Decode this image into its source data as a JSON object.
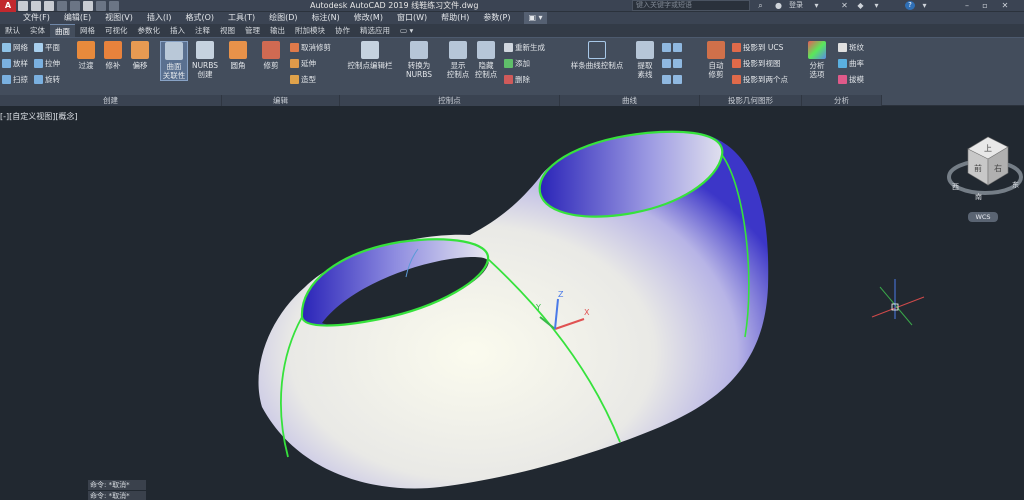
{
  "app": {
    "logo": "A",
    "title": "Autodesk AutoCAD 2019    线鞋练习文件.dwg",
    "search_placeholder": "键入关键字或短语",
    "login": "登录",
    "help": "?"
  },
  "menu": [
    "文件(F)",
    "编辑(E)",
    "视图(V)",
    "插入(I)",
    "格式(O)",
    "工具(T)",
    "绘图(D)",
    "标注(N)",
    "修改(M)",
    "窗口(W)",
    "帮助(H)",
    "参数(P)",
    "▣ ▾"
  ],
  "ribbon_tabs": [
    {
      "label": "默认",
      "active": false
    },
    {
      "label": "实体",
      "active": false
    },
    {
      "label": "曲面",
      "active": true
    },
    {
      "label": "网格",
      "active": false
    },
    {
      "label": "可视化",
      "active": false
    },
    {
      "label": "参数化",
      "active": false
    },
    {
      "label": "插入",
      "active": false
    },
    {
      "label": "注释",
      "active": false
    },
    {
      "label": "视图",
      "active": false
    },
    {
      "label": "管理",
      "active": false
    },
    {
      "label": "输出",
      "active": false
    },
    {
      "label": "附加模块",
      "active": false
    },
    {
      "label": "协作",
      "active": false
    },
    {
      "label": "精选应用",
      "active": false
    },
    {
      "label": "▭ ▾",
      "active": false
    }
  ],
  "ribbon": {
    "create": {
      "label": "创建",
      "small": [
        "网络",
        "放样",
        "扫掠",
        "平面",
        "拉伸",
        "旋转"
      ],
      "big": [
        "过渡",
        "修补",
        "偏移"
      ],
      "assoc_line1": "曲面",
      "assoc_line2": "关联性",
      "nurbs_line1": "NURBS",
      "nurbs_line2": "创建"
    },
    "edit": {
      "label": "编辑",
      "fillet": "圆角",
      "trim": "修剪",
      "small": [
        "取消修剪",
        "延伸",
        "造型"
      ]
    },
    "cv": {
      "label": "控制点",
      "cv_bar": "控制点编辑栏",
      "convert_line1": "转换为",
      "convert_line2": "NURBS",
      "show_line1": "显示",
      "show_line2": "控制点",
      "hide_line1": "隐藏",
      "hide_line2": "控制点",
      "small": [
        "重新生成",
        "添加",
        "删除"
      ]
    },
    "curves": {
      "label": "曲线",
      "spline": "样条曲线控制点",
      "extract_line1": "提取",
      "extract_line2": "素线"
    },
    "project": {
      "label": "投影几何图形",
      "auto_line1": "自动",
      "auto_line2": "修剪",
      "small": [
        "投影到 UCS",
        "投影到视图",
        "投影到两个点"
      ]
    },
    "analysis": {
      "label": "分析",
      "options_line1": "分析",
      "options_line2": "选项",
      "small": [
        "斑纹",
        "曲率",
        "拔模"
      ]
    }
  },
  "viewport": {
    "label": "[-][自定义视图][概念]",
    "viewcube_top": "上",
    "viewcube_front": "前",
    "viewcube_right": "右",
    "viewcube_w": "西",
    "viewcube_s": "南",
    "viewcube_e": "东",
    "wcs": "WCS",
    "ucs_x": "X",
    "ucs_y": "Y",
    "ucs_z": "Z"
  },
  "command_history": [
    "命令: *取消*",
    "命令: *取消*"
  ],
  "colors": {
    "background": "#212830",
    "ribbon": "#434d5c",
    "surface_edge": "#36e23c",
    "surface_blue": "#3a36c8",
    "surface_light": "#f6f6e6"
  }
}
